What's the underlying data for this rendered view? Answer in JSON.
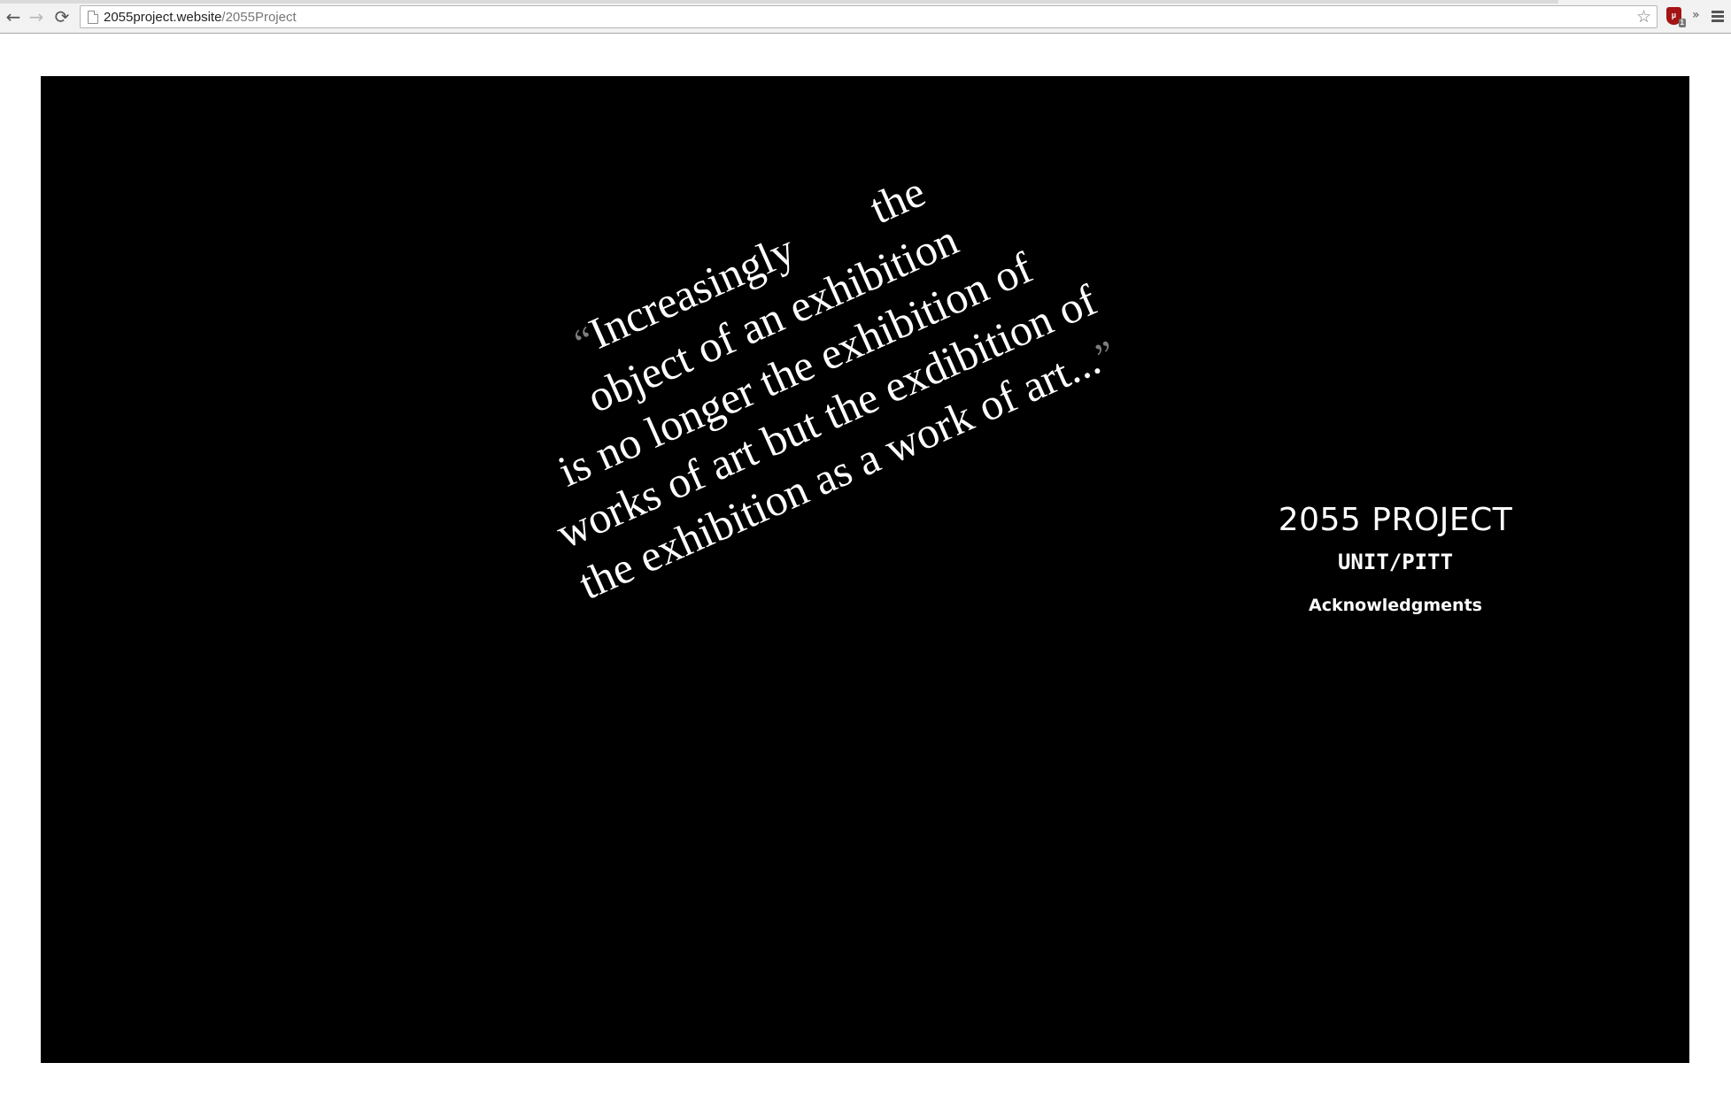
{
  "browser": {
    "url_host": "2055project.website",
    "url_path": "/2055Project",
    "extension_badge": "1"
  },
  "quote": {
    "open_mark": "“",
    "close_mark": "”",
    "line1_word1": "Increasingly",
    "line1_word2": "the",
    "line2": "object of an exhibition",
    "line3": "is no longer the exhibition of",
    "line4": "works of art but the exdibition of",
    "line5": "the exhibition as a work of art..."
  },
  "project": {
    "title": "2055 PROJECT",
    "subtitle": "UNIT/PITT",
    "acknowledgments_label": "Acknowledgments"
  },
  "icons": [
    "back-icon",
    "forward-icon",
    "reload-icon",
    "page-icon",
    "star-icon",
    "ublock-icon",
    "overflow-chevron-icon",
    "menu-icon"
  ]
}
